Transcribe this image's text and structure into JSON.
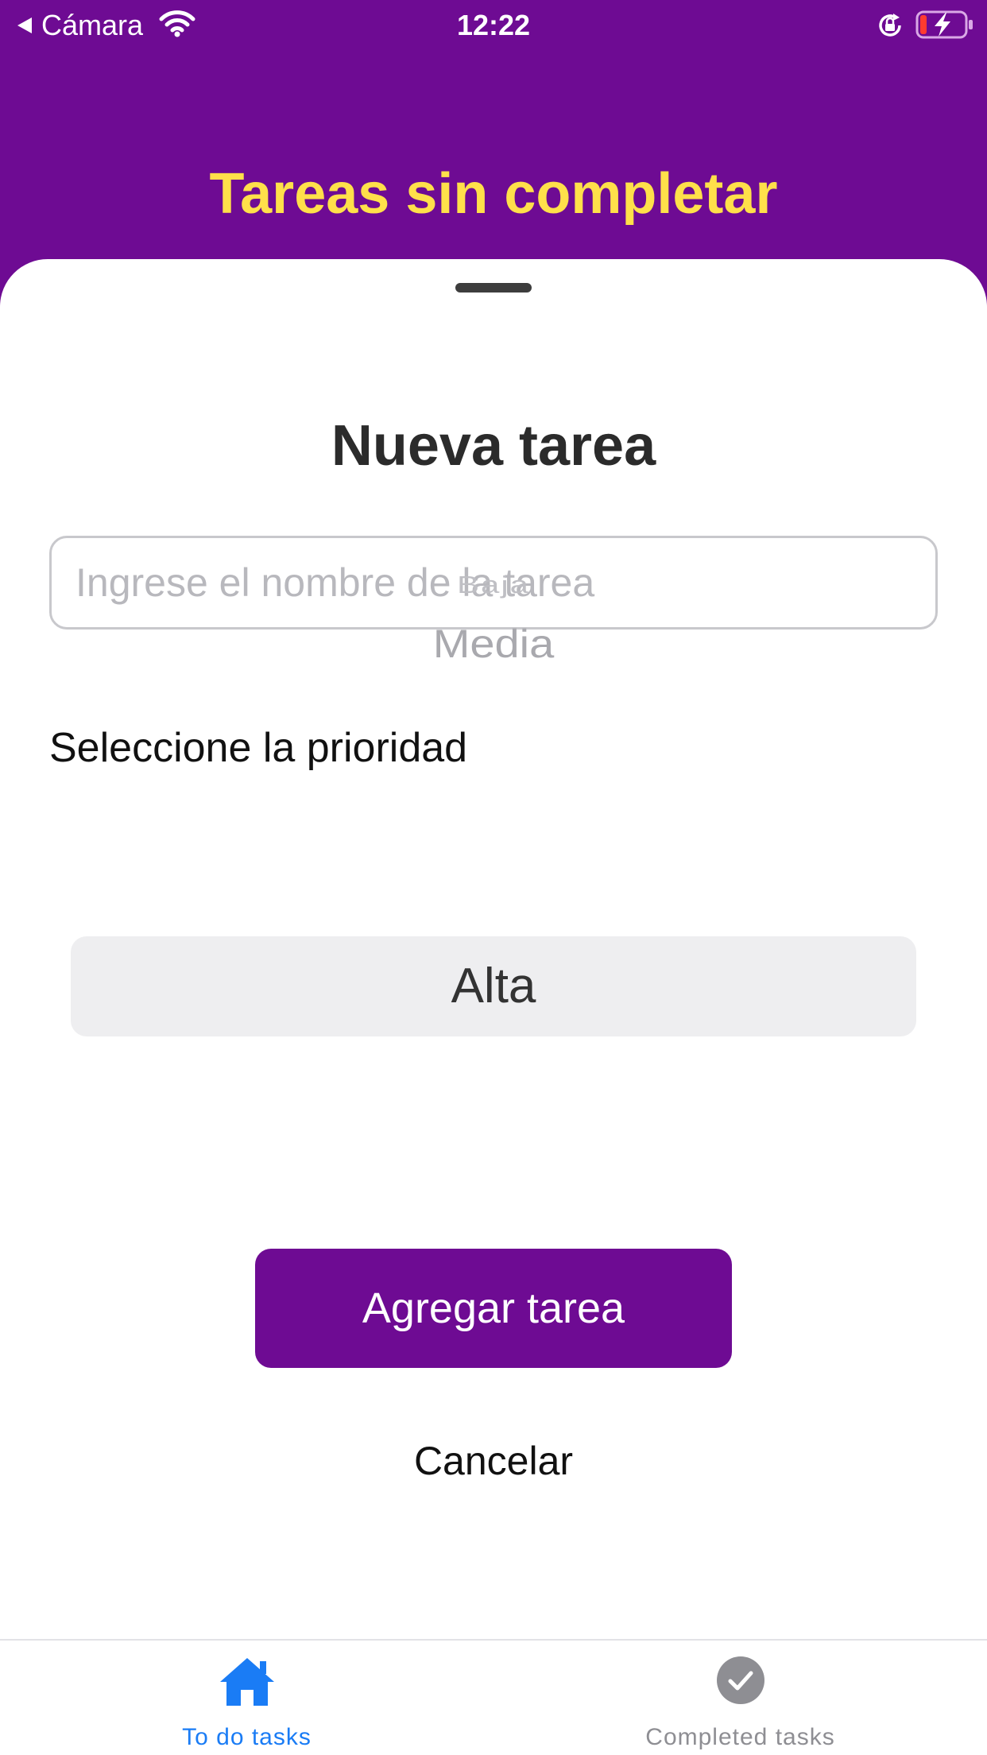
{
  "status_bar": {
    "back_label": "Cámara",
    "time": "12:22"
  },
  "header": {
    "title": "Tareas sin completar"
  },
  "sheet": {
    "title": "Nueva tarea",
    "task_input": {
      "placeholder": "Ingrese el nombre de la tarea",
      "value": ""
    },
    "priority_label": "Seleccione la prioridad",
    "priority_picker": {
      "options": [
        "Baja",
        "Media",
        "Alta"
      ],
      "selected": "Alta"
    },
    "add_button_label": "Agregar tarea",
    "cancel_button_label": "Cancelar"
  },
  "tab_bar": {
    "tabs": [
      {
        "label": "To do tasks",
        "icon": "home-icon",
        "active": true
      },
      {
        "label": "Completed tasks",
        "icon": "checkmark-circle-icon",
        "active": false
      }
    ]
  },
  "colors": {
    "brand_purple": "#6e0b93",
    "title_yellow": "#ffe04a",
    "active_tab_blue": "#1a7cf5",
    "inactive_tab_gray": "#8e8e93"
  }
}
